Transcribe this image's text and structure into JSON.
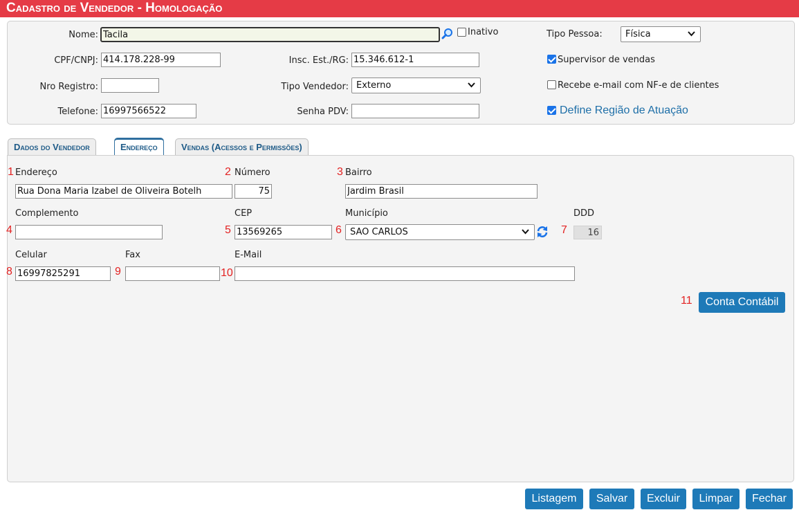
{
  "window": {
    "title": "Cadastro de Vendedor - Homologação"
  },
  "form": {
    "nome_label": "Nome:",
    "nome_value": "Tacila",
    "inativo_label": "Inativo",
    "inativo_checked": false,
    "tipo_pessoa_label": "Tipo Pessoa:",
    "tipo_pessoa_value": "Física",
    "cpf_label": "CPF/CNPJ:",
    "cpf_value": "414.178.228-99",
    "insc_label": "Insc. Est./RG:",
    "insc_value": "15.346.612-1",
    "supervisor_label": "Supervisor de vendas",
    "supervisor_checked": true,
    "nro_registro_label": "Nro Registro:",
    "nro_registro_value": "",
    "tipo_vendedor_label": "Tipo Vendedor:",
    "tipo_vendedor_value": "Externo",
    "recebe_email_label": "Recebe e-mail com NF-e de clientes",
    "recebe_email_checked": false,
    "telefone_label": "Telefone:",
    "telefone_value": "16997566522",
    "senha_pdv_label": "Senha PDV:",
    "senha_pdv_value": "",
    "define_regiao_label": "Define Região de Atuação",
    "define_regiao_checked": true
  },
  "tabs": [
    {
      "label": "Dados do Vendedor",
      "active": false
    },
    {
      "label": "Endereço",
      "active": true
    },
    {
      "label": "Vendas (Acessos e Permissões)",
      "active": false
    }
  ],
  "endereco": {
    "endereco_label": "Endereço",
    "endereco_value": "Rua Dona Maria Izabel de Oliveira Botelh",
    "numero_label": "Número",
    "numero_value": "75",
    "bairro_label": "Bairro",
    "bairro_value": "Jardim Brasil",
    "complemento_label": "Complemento",
    "complemento_value": "",
    "cep_label": "CEP",
    "cep_value": "13569265",
    "municipio_label": "Município",
    "municipio_value": "SAO CARLOS",
    "ddd_label": "DDD",
    "ddd_value": "16",
    "celular_label": "Celular",
    "celular_value": "16997825291",
    "fax_label": "Fax",
    "fax_value": "",
    "email_label": "E-Mail",
    "email_value": "",
    "conta_contabil_label": "Conta Contábil"
  },
  "annotations": [
    "1",
    "2",
    "3",
    "4",
    "5",
    "6",
    "7",
    "8",
    "9",
    "10",
    "11"
  ],
  "footer": {
    "listagem": "Listagem",
    "salvar": "Salvar",
    "excluir": "Excluir",
    "limpar": "Limpar",
    "fechar": "Fechar"
  },
  "colors": {
    "titlebar": "#e53b46",
    "button": "#1e7ab8",
    "tab_text": "#1d5a87",
    "annotation": "#e32222"
  }
}
